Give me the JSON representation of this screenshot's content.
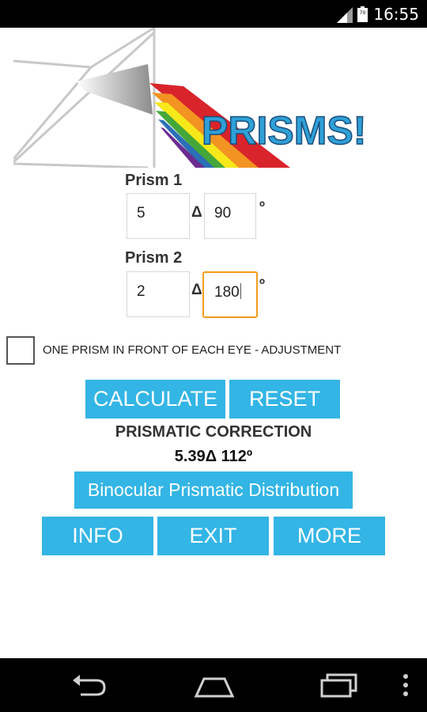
{
  "status_bar": {
    "time": "16:55",
    "battery_level": "70"
  },
  "banner": {
    "logo_text": "PRISMS!"
  },
  "prism1": {
    "label": "Prism 1",
    "power": "5",
    "power_unit": "Δ",
    "angle": "90",
    "angle_unit": "º"
  },
  "prism2": {
    "label": "Prism 2",
    "power": "2",
    "power_unit": "Δ",
    "angle": "180",
    "angle_unit": "º"
  },
  "adjustment": {
    "label": "ONE PRISM IN FRONT OF  EACH EYE - ADJUSTMENT",
    "checked": false
  },
  "buttons": {
    "calculate": "CALCULATE",
    "reset": "RESET",
    "binocular": "Binocular Prismatic Distribution",
    "info": "INFO",
    "exit": "EXIT",
    "more": "MORE"
  },
  "result": {
    "title": "PRISMATIC CORRECTION",
    "value": "5.39Δ 112º"
  },
  "colors": {
    "accent": "#33b5e5",
    "focus": "#f39c1a"
  },
  "icons": [
    "signal-icon",
    "battery-icon",
    "back-icon",
    "home-icon",
    "recent-apps-icon",
    "overflow-menu-icon"
  ]
}
